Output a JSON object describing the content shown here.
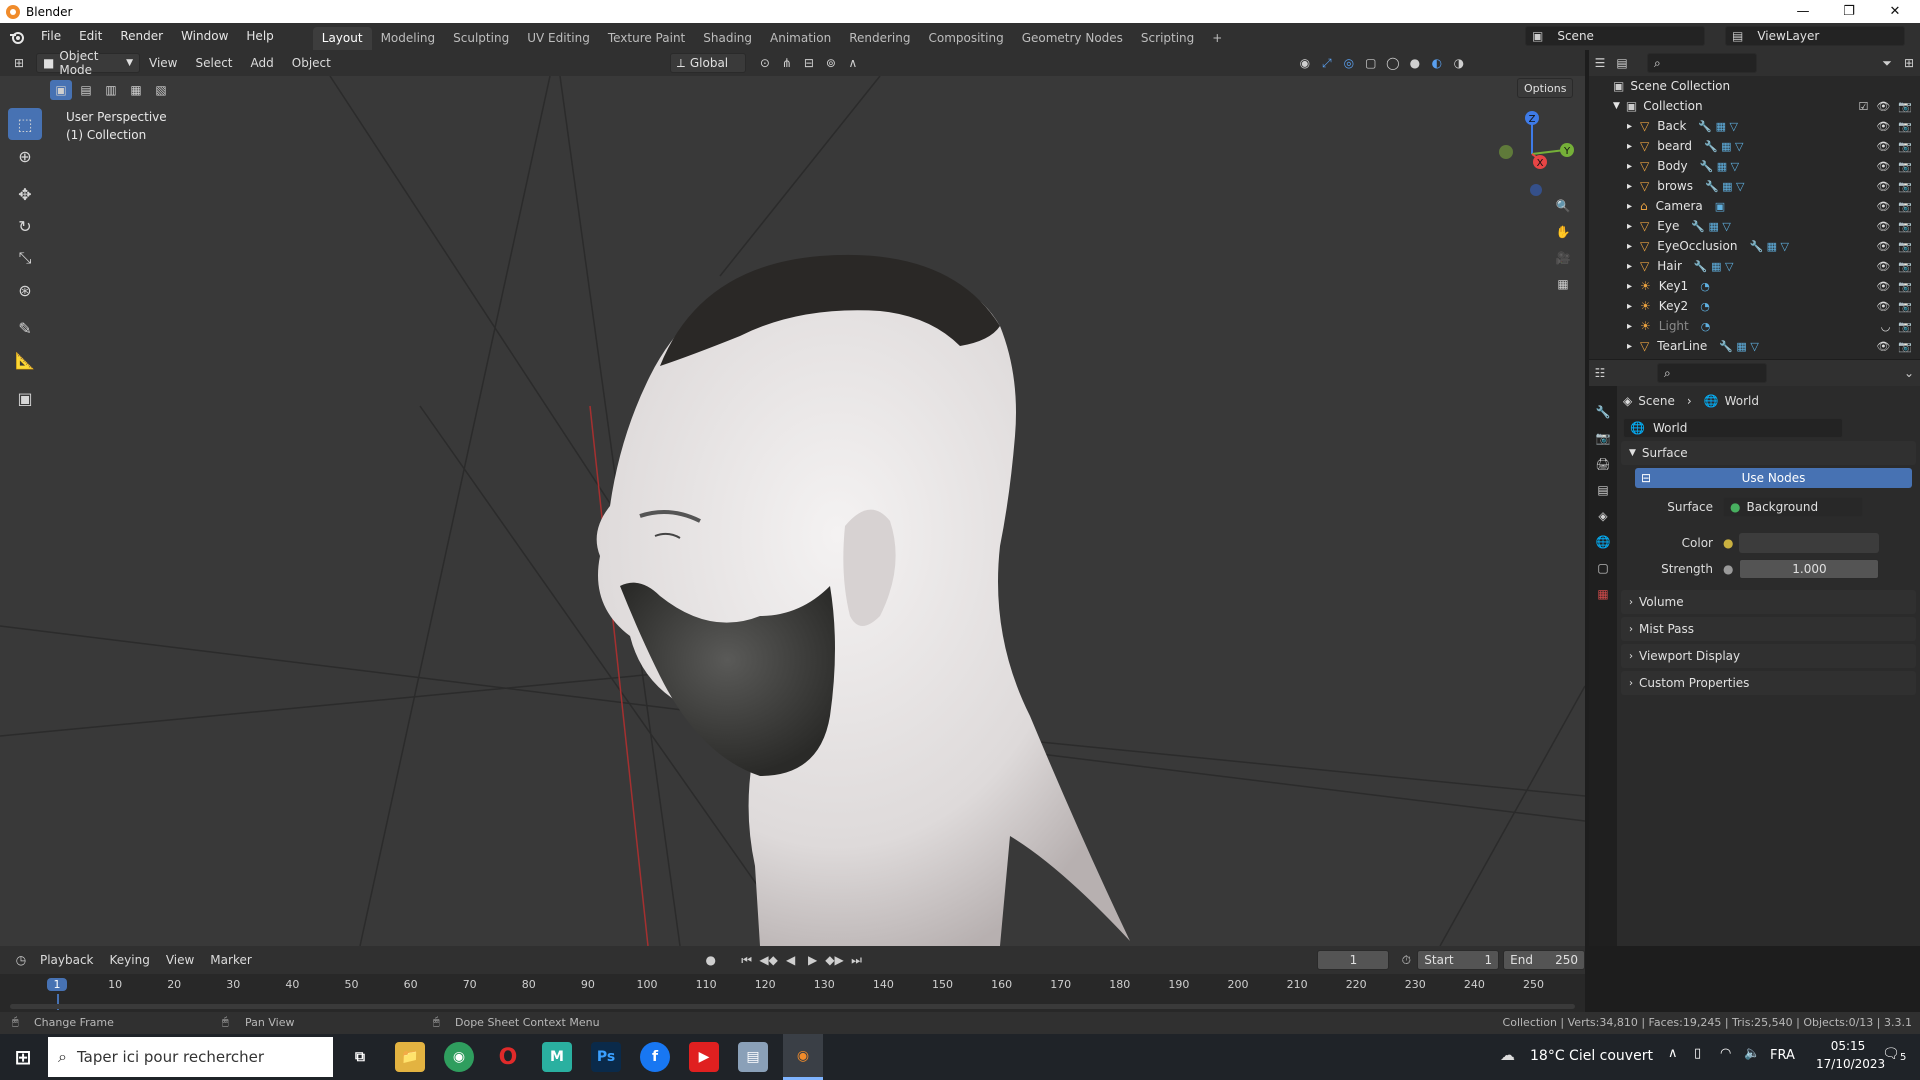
{
  "window": {
    "title": "Blender",
    "minimize": "—",
    "restore": "❐",
    "close": "✕"
  },
  "menu": {
    "items": [
      "File",
      "Edit",
      "Render",
      "Window",
      "Help"
    ],
    "workspaces": [
      "Layout",
      "Modeling",
      "Sculpting",
      "UV Editing",
      "Texture Paint",
      "Shading",
      "Animation",
      "Rendering",
      "Compositing",
      "Geometry Nodes",
      "Scripting"
    ],
    "add_tab": "+",
    "scene": "Scene",
    "view_layer": "ViewLayer"
  },
  "viewport": {
    "mode": "Object Mode",
    "menus": [
      "View",
      "Select",
      "Add",
      "Object"
    ],
    "orientation": "Global",
    "options": "Options",
    "overlay_line1": "User Perspective",
    "overlay_line2": "(1) Collection",
    "gizmo": {
      "x": "X",
      "y": "Y",
      "z": "Z"
    }
  },
  "outliner": {
    "root": "Scene Collection",
    "collection": "Collection",
    "items": [
      {
        "name": "Back",
        "type": "mesh"
      },
      {
        "name": "beard",
        "type": "mesh"
      },
      {
        "name": "Body",
        "type": "mesh"
      },
      {
        "name": "brows",
        "type": "mesh"
      },
      {
        "name": "Camera",
        "type": "camera"
      },
      {
        "name": "Eye",
        "type": "mesh"
      },
      {
        "name": "EyeOcclusion",
        "type": "mesh"
      },
      {
        "name": "Hair",
        "type": "mesh"
      },
      {
        "name": "Key1",
        "type": "light"
      },
      {
        "name": "Key2",
        "type": "light"
      },
      {
        "name": "Light",
        "type": "light"
      },
      {
        "name": "TearLine",
        "type": "mesh"
      }
    ]
  },
  "properties": {
    "breadcrumb_scene": "Scene",
    "breadcrumb_world": "World",
    "world_name": "World",
    "surface_panel": "Surface",
    "use_nodes": "Use Nodes",
    "surface_label": "Surface",
    "surface_value": "Background",
    "color_label": "Color",
    "strength_label": "Strength",
    "strength_value": "1.000",
    "panels": [
      "Volume",
      "Mist Pass",
      "Viewport Display",
      "Custom Properties"
    ]
  },
  "timeline": {
    "menus": [
      "Playback",
      "Keying",
      "View",
      "Marker"
    ],
    "current_frame": "1",
    "start_label": "Start",
    "start": "1",
    "end_label": "End",
    "end": "250",
    "ticks": [
      "1",
      "10",
      "20",
      "30",
      "40",
      "50",
      "60",
      "70",
      "80",
      "90",
      "100",
      "110",
      "120",
      "130",
      "140",
      "150",
      "160",
      "170",
      "180",
      "190",
      "200",
      "210",
      "220",
      "230",
      "240",
      "250"
    ]
  },
  "status": {
    "left1": "Change Frame",
    "left2": "Pan View",
    "left3": "Dope Sheet Context Menu",
    "right": "Collection | Verts:34,810 | Faces:19,245 | Tris:25,540 | Objects:0/13 | 3.3.1"
  },
  "taskbar": {
    "search": "Taper ici pour rechercher",
    "weather": "18°C  Ciel couvert",
    "lang": "FRA",
    "time": "05:15",
    "date": "17/10/2023",
    "notif": "5"
  }
}
